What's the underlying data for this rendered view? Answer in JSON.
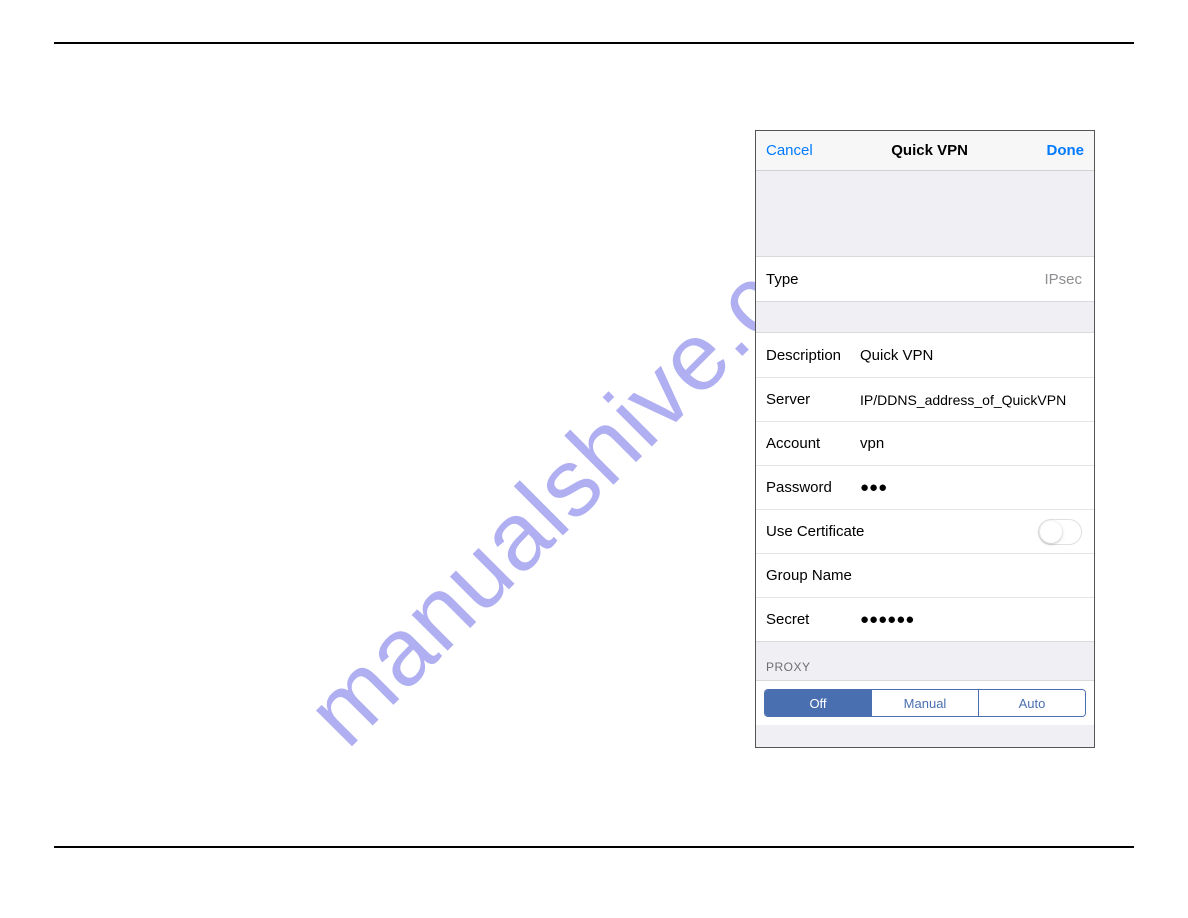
{
  "watermark": "manualshive.com",
  "navbar": {
    "cancel": "Cancel",
    "title": "Quick VPN",
    "done": "Done"
  },
  "typeRow": {
    "label": "Type",
    "value": "IPsec"
  },
  "fields": {
    "description": {
      "label": "Description",
      "value": "Quick VPN"
    },
    "server": {
      "label": "Server",
      "value": "IP/DDNS_address_of_QuickVPN"
    },
    "account": {
      "label": "Account",
      "value": "vpn"
    },
    "password": {
      "label": "Password",
      "value": "●●●"
    },
    "useCert": {
      "label": "Use Certificate"
    },
    "groupName": {
      "label": "Group Name",
      "value": ""
    },
    "secret": {
      "label": "Secret",
      "value": "●●●●●●"
    }
  },
  "proxy": {
    "header": "PROXY",
    "options": {
      "off": "Off",
      "manual": "Manual",
      "auto": "Auto"
    },
    "selected": "off"
  }
}
